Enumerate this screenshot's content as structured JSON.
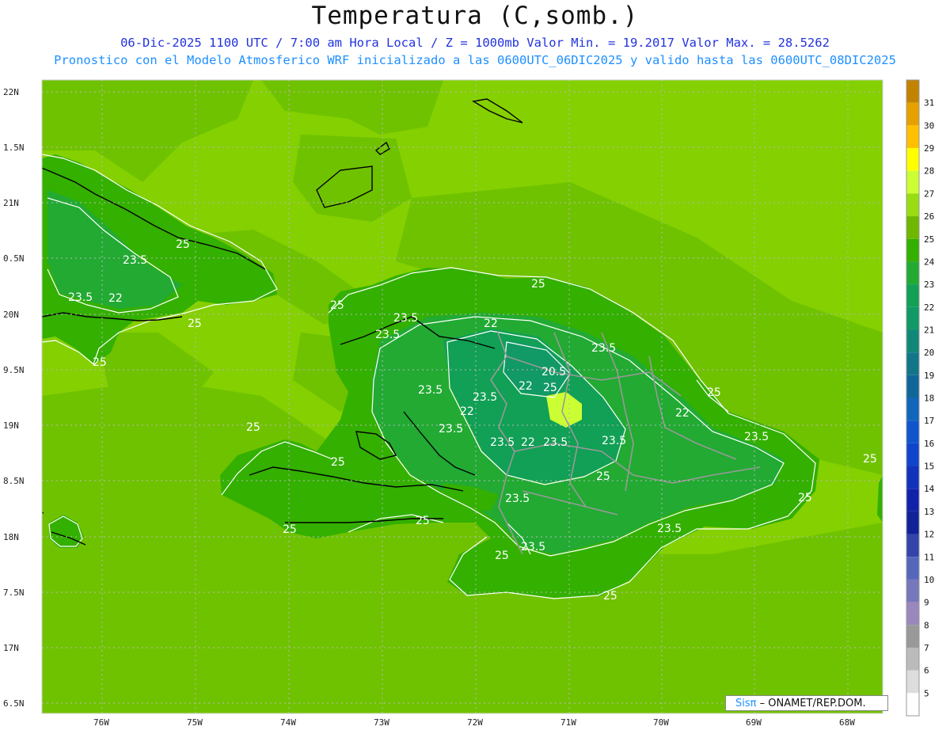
{
  "header": {
    "title": "Temperatura (C,somb.)",
    "line1": "06-Dic-2025  1100 UTC / 7:00 am Hora Local / Z = 1000mb   Valor Min. = 19.2017  Valor Max. = 28.5262",
    "line2": "Pronostico con el Modelo Atmosferico WRF inicializado a las 0600UTC_06DIC2025 y valido hasta las  0600UTC_08DIC2025"
  },
  "axes": {
    "lat_labels": [
      "22N",
      "1.5N",
      "21N",
      "0.5N",
      "20N",
      "9.5N",
      "19N",
      "8.5N",
      "18N",
      "7.5N",
      "17N",
      "6.5N"
    ],
    "lon_labels": [
      "76W",
      "75W",
      "74W",
      "73W",
      "72W",
      "71W",
      "70W",
      "69W",
      "68W"
    ]
  },
  "colorbar": {
    "levels": [
      "31",
      "30",
      "29",
      "28",
      "27",
      "26",
      "25",
      "24",
      "23",
      "22",
      "21",
      "20",
      "19",
      "18",
      "17",
      "16",
      "15",
      "14",
      "13",
      "12",
      "11",
      "10",
      "9",
      "8",
      "7",
      "6",
      "5"
    ],
    "colors": [
      "#c28300",
      "#e6a000",
      "#ffc000",
      "#ffff00",
      "#ccff33",
      "#99dd11",
      "#6fb800",
      "#33b000",
      "#22aa33",
      "#11a055",
      "#119966",
      "#118877",
      "#117788",
      "#116699",
      "#1166bb",
      "#1155cc",
      "#1144cc",
      "#1133bb",
      "#1122aa",
      "#112299",
      "#3344aa",
      "#5566bb",
      "#7777bb",
      "#9988bb",
      "#999999",
      "#bbbbbb",
      "#dddddd"
    ]
  },
  "field_colors": {
    "sea": "#84d000",
    "shelf": "#6fc200",
    "land_warm": "#33b000",
    "land_mid": "#22aa33",
    "land_cool": "#11a055",
    "land_cold": "#119966",
    "hot": "#ccff33"
  },
  "contour_labels": [
    "25",
    "23.5",
    "22",
    "20.5"
  ],
  "credit": {
    "sis": "Sisπ",
    "org": " – ONAMET/REP.DOM."
  }
}
